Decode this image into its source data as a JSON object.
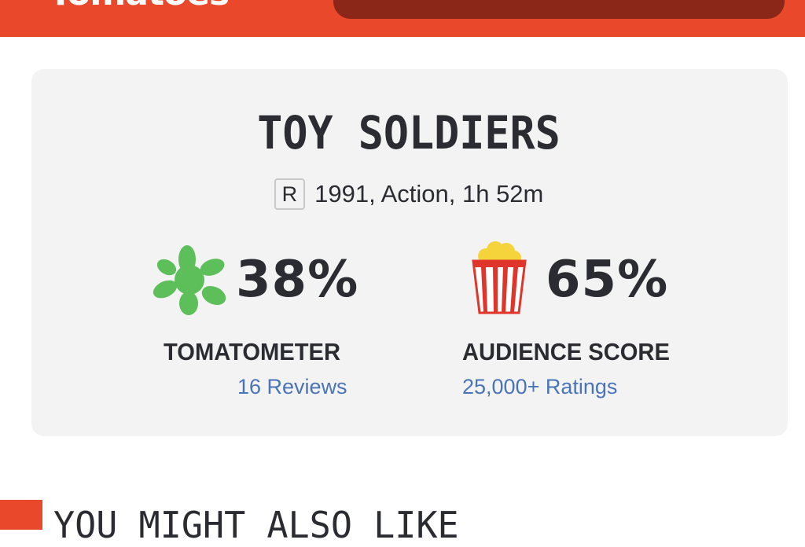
{
  "header": {
    "logo_text": "Tomatoes",
    "colors": {
      "brand": "#e9492a",
      "search": "#8a2718"
    }
  },
  "movie": {
    "title": "TOY SOLDIERS",
    "rating": "R",
    "info": "1991, Action, 1h 52m"
  },
  "scores": {
    "tomatometer": {
      "value": "38%",
      "label": "TOMATOMETER",
      "link": "16 Reviews",
      "icon": "green-splat-icon",
      "color": "#5dbf5a"
    },
    "audience": {
      "value": "65%",
      "label": "AUDIENCE SCORE",
      "link": "25,000+ Ratings",
      "icon": "popcorn-bucket-icon",
      "color": "#e0352b"
    }
  },
  "section": {
    "title": "YOU MIGHT ALSO LIKE"
  }
}
